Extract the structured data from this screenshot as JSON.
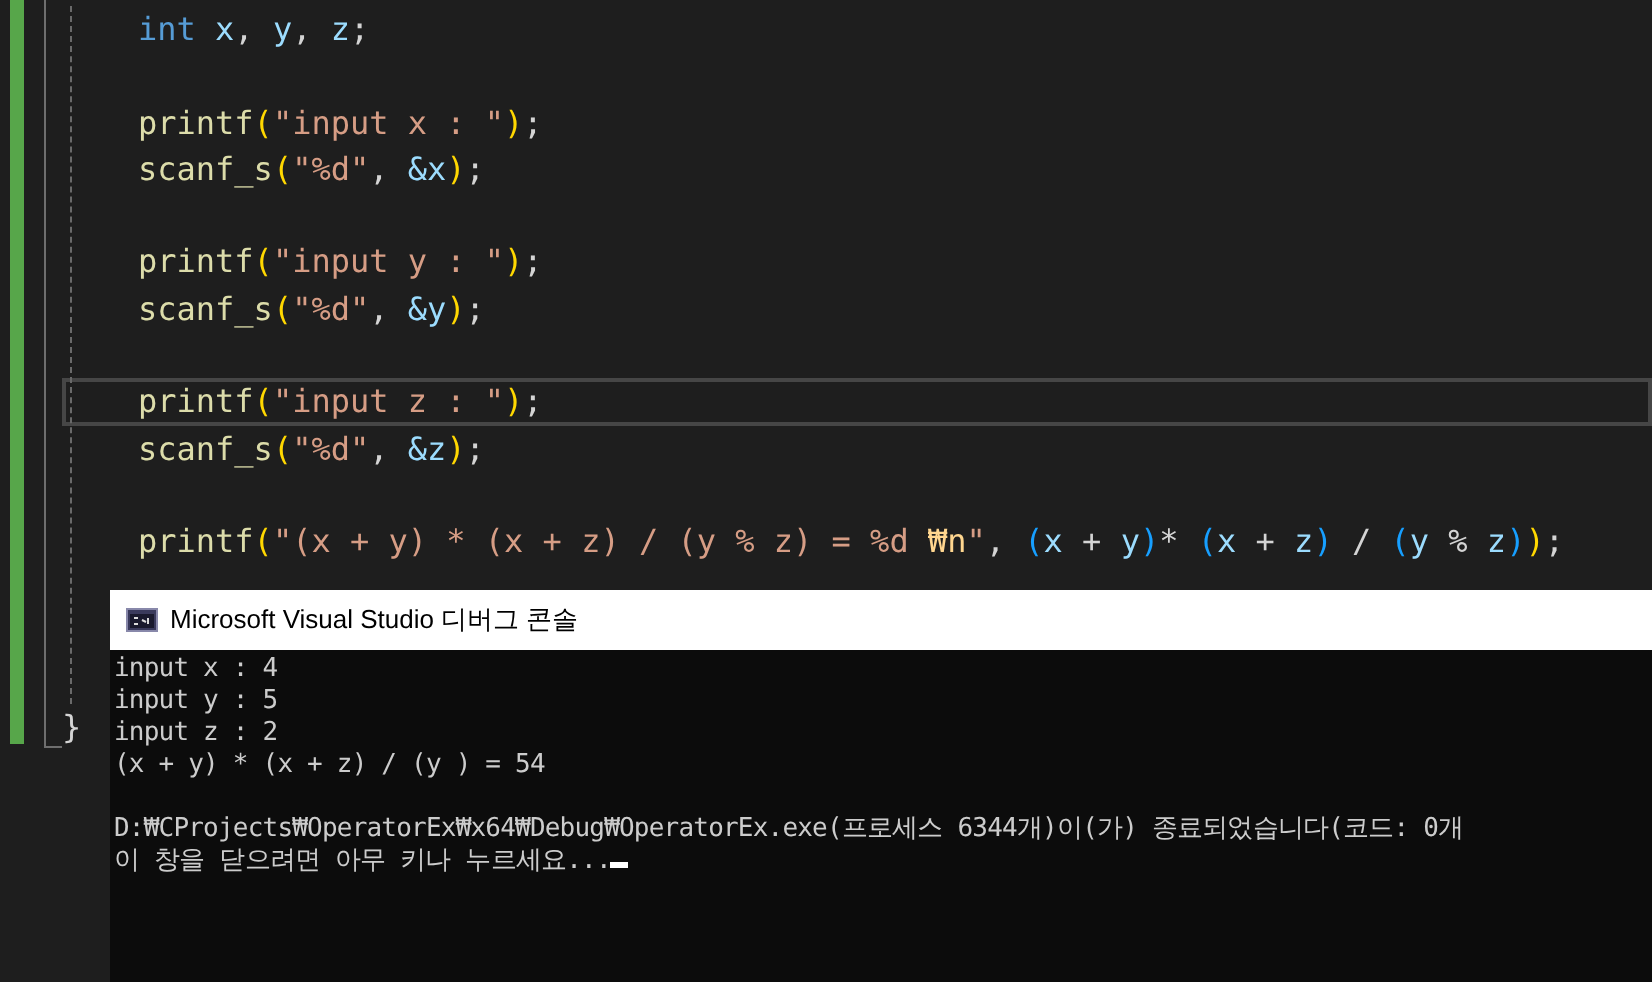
{
  "editor": {
    "block": {
      "lines": [
        {
          "kind": "code",
          "current": false,
          "tokens": [
            {
              "text": "int ",
              "kind": "keyword"
            },
            {
              "text": "x",
              "kind": "variable"
            },
            {
              "text": ", ",
              "kind": "plain"
            },
            {
              "text": "y",
              "kind": "variable"
            },
            {
              "text": ", ",
              "kind": "plain"
            },
            {
              "text": "z",
              "kind": "variable"
            },
            {
              "text": ";",
              "kind": "plain"
            }
          ]
        },
        {
          "kind": "blank"
        },
        {
          "kind": "code",
          "current": false,
          "tokens": [
            {
              "text": "printf",
              "kind": "function"
            },
            {
              "text": "(",
              "kind": "bracket"
            },
            {
              "text": "\"input x : \"",
              "kind": "string"
            },
            {
              "text": ")",
              "kind": "bracket"
            },
            {
              "text": ";",
              "kind": "plain"
            }
          ]
        },
        {
          "kind": "code",
          "current": false,
          "tokens": [
            {
              "text": "scanf_s",
              "kind": "function"
            },
            {
              "text": "(",
              "kind": "bracket"
            },
            {
              "text": "\"%d\"",
              "kind": "string"
            },
            {
              "text": ", ",
              "kind": "plain"
            },
            {
              "text": "&x",
              "kind": "variable"
            },
            {
              "text": ")",
              "kind": "bracket"
            },
            {
              "text": ";",
              "kind": "plain"
            }
          ]
        },
        {
          "kind": "blank"
        },
        {
          "kind": "code",
          "current": false,
          "tokens": [
            {
              "text": "printf",
              "kind": "function"
            },
            {
              "text": "(",
              "kind": "bracket"
            },
            {
              "text": "\"input y : \"",
              "kind": "string"
            },
            {
              "text": ")",
              "kind": "bracket"
            },
            {
              "text": ";",
              "kind": "plain"
            }
          ]
        },
        {
          "kind": "code",
          "current": false,
          "tokens": [
            {
              "text": "scanf_s",
              "kind": "function"
            },
            {
              "text": "(",
              "kind": "bracket"
            },
            {
              "text": "\"%d\"",
              "kind": "string"
            },
            {
              "text": ", ",
              "kind": "plain"
            },
            {
              "text": "&y",
              "kind": "variable"
            },
            {
              "text": ")",
              "kind": "bracket"
            },
            {
              "text": ";",
              "kind": "plain"
            }
          ]
        },
        {
          "kind": "blank"
        },
        {
          "kind": "code",
          "current": true,
          "tokens": [
            {
              "text": "printf",
              "kind": "function"
            },
            {
              "text": "(",
              "kind": "bracket"
            },
            {
              "text": "\"input z : \"",
              "kind": "string"
            },
            {
              "text": ")",
              "kind": "bracket"
            },
            {
              "text": ";",
              "kind": "plain"
            }
          ]
        },
        {
          "kind": "code",
          "current": false,
          "tokens": [
            {
              "text": "scanf_s",
              "kind": "function"
            },
            {
              "text": "(",
              "kind": "bracket"
            },
            {
              "text": "\"%d\"",
              "kind": "string"
            },
            {
              "text": ", ",
              "kind": "plain"
            },
            {
              "text": "&z",
              "kind": "variable"
            },
            {
              "text": ")",
              "kind": "bracket"
            },
            {
              "text": ";",
              "kind": "plain"
            }
          ]
        },
        {
          "kind": "blank"
        },
        {
          "kind": "code",
          "current": false,
          "tokens": [
            {
              "text": "printf",
              "kind": "function"
            },
            {
              "text": "(",
              "kind": "bracket"
            },
            {
              "text": "\"(x + y) * (x + z) / (y % z) = %d ",
              "kind": "string"
            },
            {
              "text": "₩n",
              "kind": "escape"
            },
            {
              "text": "\"",
              "kind": "string"
            },
            {
              "text": ", ",
              "kind": "plain"
            },
            {
              "text": "(",
              "kind": "bracket2"
            },
            {
              "text": "x",
              "kind": "variable"
            },
            {
              "text": " + ",
              "kind": "plain"
            },
            {
              "text": "y",
              "kind": "variable"
            },
            {
              "text": ")",
              "kind": "bracket2"
            },
            {
              "text": "* ",
              "kind": "plain"
            },
            {
              "text": "(",
              "kind": "bracket2"
            },
            {
              "text": "x",
              "kind": "variable"
            },
            {
              "text": " + ",
              "kind": "plain"
            },
            {
              "text": "z",
              "kind": "variable"
            },
            {
              "text": ")",
              "kind": "bracket2"
            },
            {
              "text": " / ",
              "kind": "plain"
            },
            {
              "text": "(",
              "kind": "bracket2"
            },
            {
              "text": "y",
              "kind": "variable"
            },
            {
              "text": " % ",
              "kind": "plain"
            },
            {
              "text": "z",
              "kind": "variable"
            },
            {
              "text": ")",
              "kind": "bracket2"
            },
            {
              "text": ")",
              "kind": "bracket"
            },
            {
              "text": ";",
              "kind": "plain"
            }
          ]
        }
      ],
      "closing": "}"
    }
  },
  "console": {
    "title": "Microsoft Visual Studio 디버그 콘솔",
    "lines": [
      {
        "kind": "text",
        "text": "input x : 4"
      },
      {
        "kind": "text",
        "text": "input y : 5"
      },
      {
        "kind": "text",
        "text": "input z : 2"
      },
      {
        "kind": "text",
        "text": "(x + y) * (x + z) / (y ) = 54"
      },
      {
        "kind": "blank"
      },
      {
        "kind": "text",
        "text": "D:₩CProjects₩OperatorEx₩x64₩Debug₩OperatorEx.exe(프로세스 6344개)이(가) 종료되었습니다(코드: 0개"
      },
      {
        "kind": "text",
        "text": "이 창을 닫으려면 아무 키나 누르세요..."
      }
    ],
    "cursor": true
  }
}
